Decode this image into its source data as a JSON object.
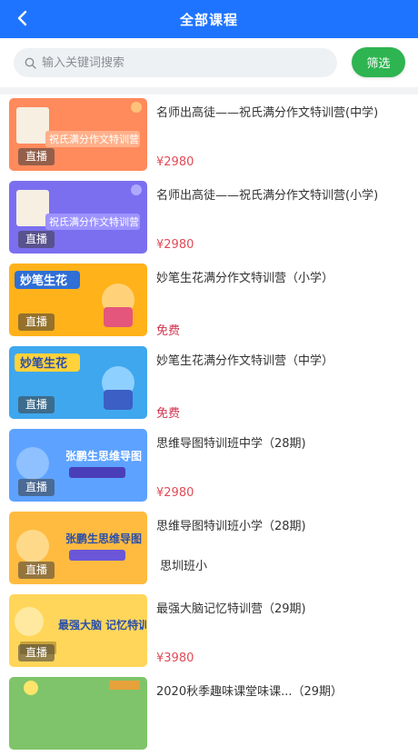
{
  "header": {
    "title": "全部课程",
    "back_icon": "chevron-left-icon"
  },
  "search": {
    "placeholder": "输入关键词搜索",
    "icon": "search-icon"
  },
  "filter": {
    "label": "筛选"
  },
  "courses": [
    {
      "name": "名师出高徒——祝氏满分作文特训营(中学)",
      "price": "¥2980",
      "badge": "直播",
      "thumb_bg": "#ff8a5c",
      "thumb_text": "祝氏满分作文特训营"
    },
    {
      "name": "名师出高徒——祝氏满分作文特训营(小学)",
      "price": "¥2980",
      "badge": "直播",
      "thumb_bg": "#7b6ff0",
      "thumb_text": "祝氏满分作文特训营"
    },
    {
      "name": "妙笔生花满分作文特训营（小学）",
      "price": "免费",
      "badge": "直播",
      "thumb_bg": "#ffb21a",
      "thumb_text": "妙笔生花"
    },
    {
      "name": "妙笔生花满分作文特训营（中学）",
      "price": "免费",
      "badge": "直播",
      "thumb_bg": "#3fa7ee",
      "thumb_text": "妙笔生花"
    },
    {
      "name": "思维导图特训班中学（28期)",
      "price": "¥2980",
      "badge": "直播",
      "thumb_bg": "#5da2ff",
      "thumb_text": "张鹏生思维导图"
    },
    {
      "name": "思维导图特训班小学（28期)",
      "price": "",
      "sub": "思圳班小",
      "badge": "直播",
      "thumb_bg": "#ffbb40",
      "thumb_text": "张鹏生思维导图"
    },
    {
      "name": "最强大脑记忆特训营（29期)",
      "price": "¥3980",
      "badge": "直播",
      "thumb_bg": "#ffd65a",
      "thumb_text": "最强大脑 记忆特训营"
    },
    {
      "name": "2020秋季趣味课堂味课...（29期）",
      "price": "",
      "badge": "",
      "thumb_bg": "#7fc46a",
      "thumb_text": ""
    }
  ]
}
